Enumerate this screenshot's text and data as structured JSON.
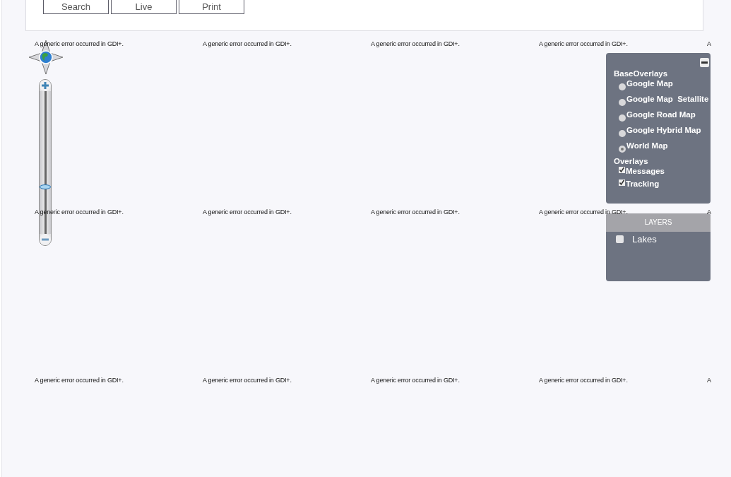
{
  "toolbar": {
    "buttons": [
      {
        "label": "Search"
      },
      {
        "label": "Live"
      },
      {
        "label": "Print"
      }
    ]
  },
  "map": {
    "tiles": [
      [
        "A generic error occurred in GDI+.",
        "A generic error occurred in GDI+.",
        "A generic error occurred in GDI+.",
        "A generic error occurred in GDI+.",
        "A"
      ],
      [
        "A generic error occurred in GDI+.",
        "A generic error occurred in GDI+.",
        "A generic error occurred in GDI+.",
        "A generic error occurred in GDI+.",
        "A"
      ],
      [
        "A generic error occurred in GDI+.",
        "A generic error occurred in GDI+.",
        "A generic error occurred in GDI+.",
        "A generic error occurred in GDI+.",
        "A"
      ]
    ],
    "zoom": {
      "level": 0.33
    }
  },
  "layer_switcher": {
    "base_title": "BaseOverlays",
    "base_layers": [
      {
        "label": "Google Map",
        "selected": false
      },
      {
        "label": "Google Map  Setallite",
        "selected": false
      },
      {
        "label": "Google Road Map",
        "selected": false
      },
      {
        "label": "Google Hybrid Map",
        "selected": false
      },
      {
        "label": "World Map",
        "selected": true
      }
    ],
    "overlays_title": "Overlays",
    "overlays": [
      {
        "label": "Messages",
        "checked": true
      },
      {
        "label": "Tracking",
        "checked": true
      }
    ]
  },
  "layers_panel": {
    "title": "LAYERS",
    "items": [
      {
        "label": "Lakes",
        "checked": false
      }
    ]
  }
}
